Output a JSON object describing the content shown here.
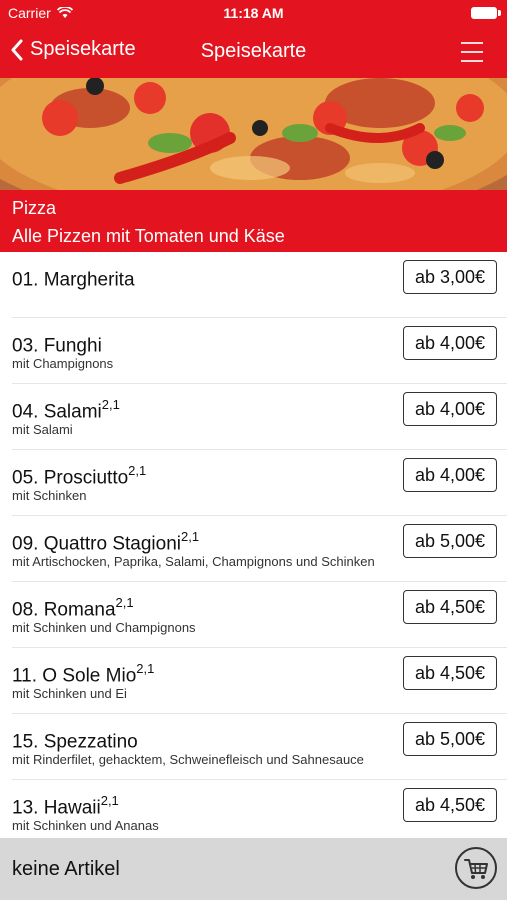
{
  "status": {
    "carrier": "Carrier",
    "time": "11:18 AM"
  },
  "nav": {
    "back_label": "Speisekarte",
    "title": "Speisekarte"
  },
  "category": {
    "name": "Pizza",
    "description": "Alle Pizzen mit Tomaten und Käse"
  },
  "items": [
    {
      "name": "01. Margherita",
      "sup": "",
      "desc": "",
      "price": "ab 3,00€"
    },
    {
      "name": "03. Funghi",
      "sup": "",
      "desc": "mit Champignons",
      "price": "ab 4,00€"
    },
    {
      "name": "04. Salami",
      "sup": "2,1",
      "desc": "mit Salami",
      "price": "ab 4,00€"
    },
    {
      "name": "05. Prosciutto",
      "sup": "2,1",
      "desc": "mit Schinken",
      "price": "ab 4,00€"
    },
    {
      "name": "09. Quattro Stagioni",
      "sup": "2,1",
      "desc": "mit Artischocken, Paprika, Salami, Champignons und Schinken",
      "price": "ab 5,00€"
    },
    {
      "name": "08. Romana",
      "sup": "2,1",
      "desc": "mit Schinken und Champignons",
      "price": "ab 4,50€"
    },
    {
      "name": "11. O Sole Mio",
      "sup": "2,1",
      "desc": "mit Schinken und Ei",
      "price": "ab 4,50€"
    },
    {
      "name": "15. Spezzatino",
      "sup": "",
      "desc": "mit Rinderfilet, gehacktem, Schweinefleisch und Sahnesauce",
      "price": "ab 5,00€"
    },
    {
      "name": "13. Hawaii",
      "sup": "2,1",
      "desc": "mit Schinken und Ananas",
      "price": "ab 4,50€"
    }
  ],
  "cart": {
    "label": "keine Artikel",
    "icon": "shopping-cart-icon"
  },
  "colors": {
    "accent": "#e3141f",
    "footer_bg": "#d7d7d7"
  }
}
